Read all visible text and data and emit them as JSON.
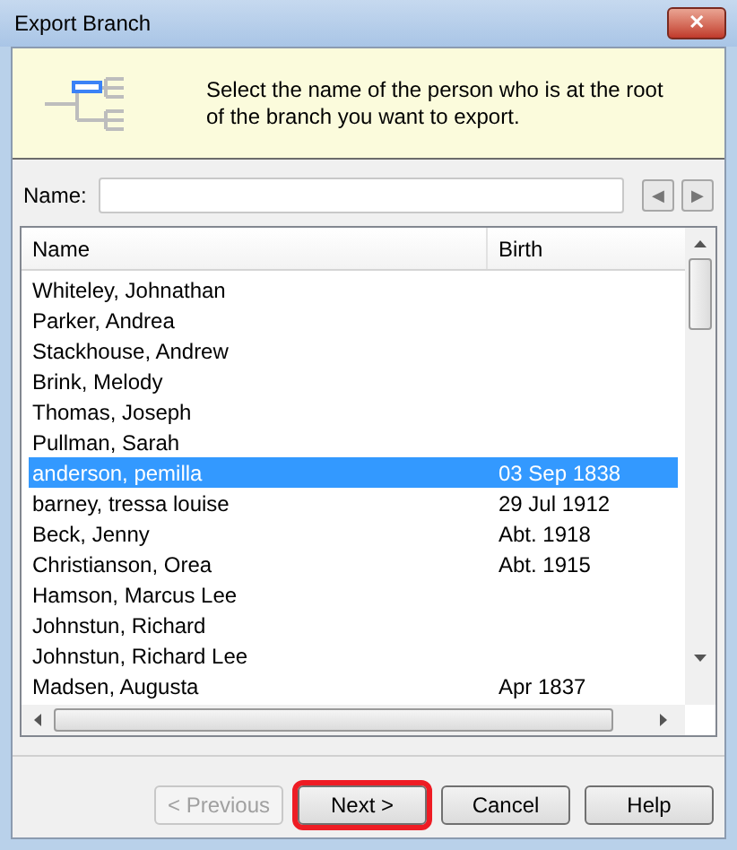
{
  "window": {
    "title": "Export Branch",
    "close": "✕"
  },
  "banner": {
    "text": "Select the name of the person who is at the root of the branch you want to export."
  },
  "name_field": {
    "label": "Name:",
    "prev": "◀",
    "next": "▶"
  },
  "table": {
    "columns": [
      "Name",
      "Birth"
    ],
    "rows": [
      {
        "name": "Whiteley, Johnathan",
        "birth": "",
        "selected": false
      },
      {
        "name": "Parker, Andrea",
        "birth": "",
        "selected": false
      },
      {
        "name": "Stackhouse, Andrew",
        "birth": "",
        "selected": false
      },
      {
        "name": "Brink, Melody",
        "birth": "",
        "selected": false
      },
      {
        "name": "Thomas, Joseph",
        "birth": "",
        "selected": false
      },
      {
        "name": "Pullman, Sarah",
        "birth": "",
        "selected": false
      },
      {
        "name": "anderson, pemilla",
        "birth": "03 Sep 1838",
        "selected": true
      },
      {
        "name": "barney, tressa louise",
        "birth": "29 Jul 1912",
        "selected": false
      },
      {
        "name": "Beck, Jenny",
        "birth": "Abt. 1918",
        "selected": false
      },
      {
        "name": "Christianson, Orea",
        "birth": "Abt. 1915",
        "selected": false
      },
      {
        "name": "Hamson, Marcus Lee",
        "birth": "",
        "selected": false
      },
      {
        "name": "Johnstun, Richard",
        "birth": "",
        "selected": false
      },
      {
        "name": "Johnstun, Richard Lee",
        "birth": "",
        "selected": false
      },
      {
        "name": "Madsen, Augusta",
        "birth": "Apr 1837",
        "selected": false
      }
    ]
  },
  "buttons": [
    {
      "label": "< Previous",
      "disabled": true,
      "highlighted": false
    },
    {
      "label": "Next >",
      "disabled": false,
      "highlighted": true
    },
    {
      "label": "Cancel",
      "disabled": false,
      "highlighted": false
    },
    {
      "label": "Help",
      "disabled": false,
      "highlighted": false
    }
  ]
}
